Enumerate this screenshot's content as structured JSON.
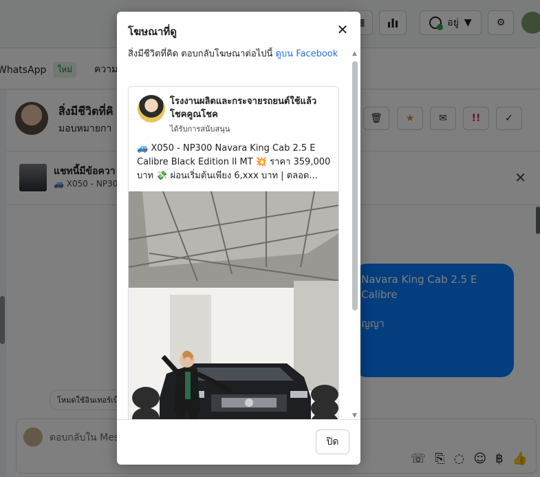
{
  "background": {
    "topbar": {
      "status_label": "อยู่"
    },
    "tabs": [
      {
        "label": "WhatsApp",
        "badge": "ใหม่"
      },
      {
        "label": "ความเ"
      }
    ],
    "chat_header": {
      "name": "สิ่งมีชีวิตที่คิ",
      "sub": "มอบหมายกา"
    },
    "ad_bar": {
      "title": "แชทนี้มีข้อควา",
      "sub": "🚙 X050 - NP30"
    },
    "bubble_lines": [
      "Navara King Cab 2.5 E Calibre",
      "ญญา"
    ],
    "system_note": "โหมดใช้อินเทอร์เน็ต",
    "composer_placeholder": "ตอบกลับใน Mes"
  },
  "modal": {
    "title": "โฆษณาที่ดู",
    "intro_text": "สิ่งมีชีวิตที่คิด ตอบกลับโฆษณาต่อไปนี้",
    "intro_link": "ดูบน Facebook",
    "ad": {
      "page_name": "โรงงานผลิตและกระจายรถยนต์ใช้แล้ว โชคคูณโชค",
      "sponsored": "ได้รับการสนับสนุน",
      "text": "🚙 X050 - NP300 Navara King Cab 2.5 E Calibre Black Edition ll MT 💥 ราคา 359,000 บาท 💸 ผ่อนเริ่มต้นเพียง 6,xxx บาท | ตลอด..."
    },
    "close_button": "ปิด"
  },
  "colors": {
    "accent": "#216fdb",
    "bubble": "#0a7cff",
    "overlay": "rgba(0,0,0,0.5)"
  }
}
